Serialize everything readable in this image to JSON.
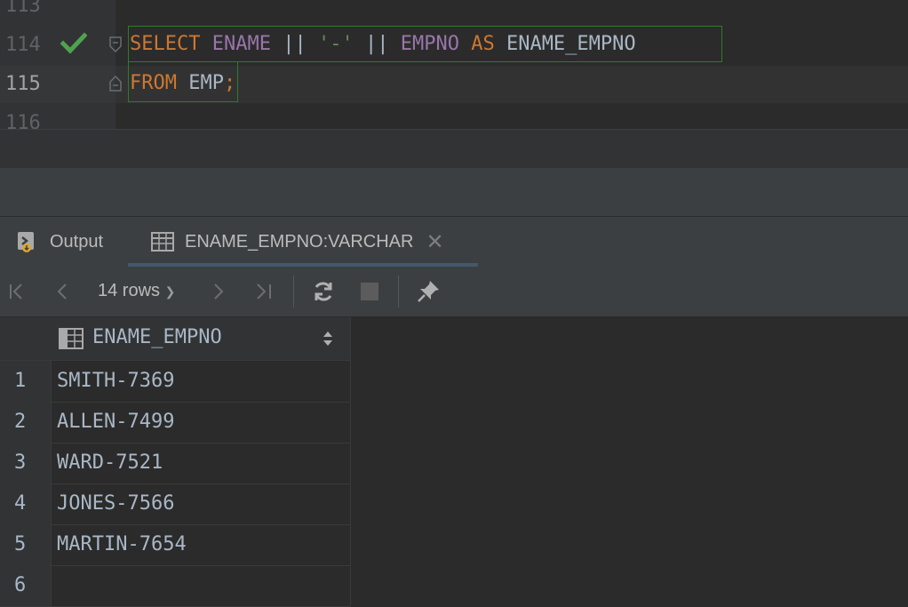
{
  "editor": {
    "line_numbers": [
      "113",
      "114",
      "115",
      "116"
    ],
    "line1": {
      "kw_select": "SELECT",
      "col_ename": "ENAME",
      "op1": "||",
      "str_dash": "'-'",
      "op2": "||",
      "col_empno": "EMPNO",
      "kw_as": "AS",
      "alias": "ENAME_EMPNO"
    },
    "line2": {
      "kw_from": "FROM",
      "table": "EMP",
      "semicolon": ";"
    }
  },
  "tabs": {
    "output_label": "Output",
    "result_label": "ENAME_EMPNO:VARCHAR"
  },
  "toolbar": {
    "rows_label": "14 rows"
  },
  "grid": {
    "column": "ENAME_EMPNO",
    "rows": [
      {
        "n": "1",
        "v": "SMITH-7369"
      },
      {
        "n": "2",
        "v": "ALLEN-7499"
      },
      {
        "n": "3",
        "v": "WARD-7521"
      },
      {
        "n": "4",
        "v": "JONES-7566"
      },
      {
        "n": "5",
        "v": "MARTIN-7654"
      },
      {
        "n": "6",
        "v": ""
      }
    ]
  },
  "colors": {
    "keyword": "#cc7832",
    "column": "#9876aa",
    "string": "#6a8759",
    "success": "#4fa24f"
  }
}
